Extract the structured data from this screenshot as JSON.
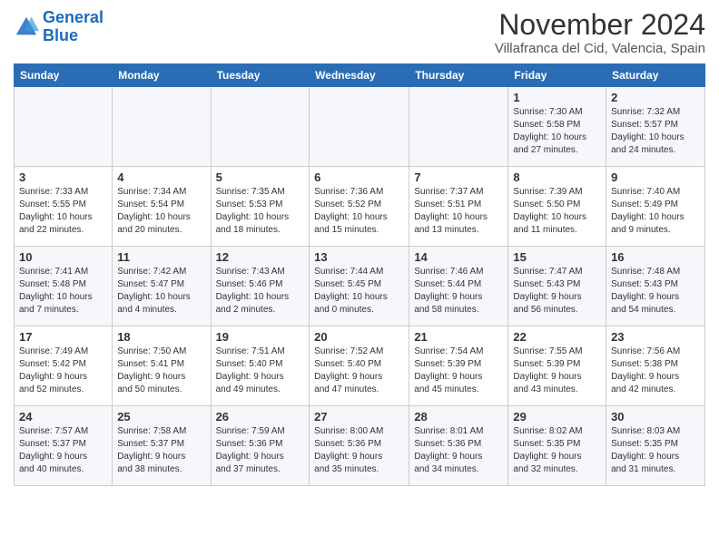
{
  "header": {
    "logo_line1": "General",
    "logo_line2": "Blue",
    "month": "November 2024",
    "location": "Villafranca del Cid, Valencia, Spain"
  },
  "weekdays": [
    "Sunday",
    "Monday",
    "Tuesday",
    "Wednesday",
    "Thursday",
    "Friday",
    "Saturday"
  ],
  "weeks": [
    [
      {
        "day": "",
        "info": ""
      },
      {
        "day": "",
        "info": ""
      },
      {
        "day": "",
        "info": ""
      },
      {
        "day": "",
        "info": ""
      },
      {
        "day": "",
        "info": ""
      },
      {
        "day": "1",
        "info": "Sunrise: 7:30 AM\nSunset: 5:58 PM\nDaylight: 10 hours\nand 27 minutes."
      },
      {
        "day": "2",
        "info": "Sunrise: 7:32 AM\nSunset: 5:57 PM\nDaylight: 10 hours\nand 24 minutes."
      }
    ],
    [
      {
        "day": "3",
        "info": "Sunrise: 7:33 AM\nSunset: 5:55 PM\nDaylight: 10 hours\nand 22 minutes."
      },
      {
        "day": "4",
        "info": "Sunrise: 7:34 AM\nSunset: 5:54 PM\nDaylight: 10 hours\nand 20 minutes."
      },
      {
        "day": "5",
        "info": "Sunrise: 7:35 AM\nSunset: 5:53 PM\nDaylight: 10 hours\nand 18 minutes."
      },
      {
        "day": "6",
        "info": "Sunrise: 7:36 AM\nSunset: 5:52 PM\nDaylight: 10 hours\nand 15 minutes."
      },
      {
        "day": "7",
        "info": "Sunrise: 7:37 AM\nSunset: 5:51 PM\nDaylight: 10 hours\nand 13 minutes."
      },
      {
        "day": "8",
        "info": "Sunrise: 7:39 AM\nSunset: 5:50 PM\nDaylight: 10 hours\nand 11 minutes."
      },
      {
        "day": "9",
        "info": "Sunrise: 7:40 AM\nSunset: 5:49 PM\nDaylight: 10 hours\nand 9 minutes."
      }
    ],
    [
      {
        "day": "10",
        "info": "Sunrise: 7:41 AM\nSunset: 5:48 PM\nDaylight: 10 hours\nand 7 minutes."
      },
      {
        "day": "11",
        "info": "Sunrise: 7:42 AM\nSunset: 5:47 PM\nDaylight: 10 hours\nand 4 minutes."
      },
      {
        "day": "12",
        "info": "Sunrise: 7:43 AM\nSunset: 5:46 PM\nDaylight: 10 hours\nand 2 minutes."
      },
      {
        "day": "13",
        "info": "Sunrise: 7:44 AM\nSunset: 5:45 PM\nDaylight: 10 hours\nand 0 minutes."
      },
      {
        "day": "14",
        "info": "Sunrise: 7:46 AM\nSunset: 5:44 PM\nDaylight: 9 hours\nand 58 minutes."
      },
      {
        "day": "15",
        "info": "Sunrise: 7:47 AM\nSunset: 5:43 PM\nDaylight: 9 hours\nand 56 minutes."
      },
      {
        "day": "16",
        "info": "Sunrise: 7:48 AM\nSunset: 5:43 PM\nDaylight: 9 hours\nand 54 minutes."
      }
    ],
    [
      {
        "day": "17",
        "info": "Sunrise: 7:49 AM\nSunset: 5:42 PM\nDaylight: 9 hours\nand 52 minutes."
      },
      {
        "day": "18",
        "info": "Sunrise: 7:50 AM\nSunset: 5:41 PM\nDaylight: 9 hours\nand 50 minutes."
      },
      {
        "day": "19",
        "info": "Sunrise: 7:51 AM\nSunset: 5:40 PM\nDaylight: 9 hours\nand 49 minutes."
      },
      {
        "day": "20",
        "info": "Sunrise: 7:52 AM\nSunset: 5:40 PM\nDaylight: 9 hours\nand 47 minutes."
      },
      {
        "day": "21",
        "info": "Sunrise: 7:54 AM\nSunset: 5:39 PM\nDaylight: 9 hours\nand 45 minutes."
      },
      {
        "day": "22",
        "info": "Sunrise: 7:55 AM\nSunset: 5:39 PM\nDaylight: 9 hours\nand 43 minutes."
      },
      {
        "day": "23",
        "info": "Sunrise: 7:56 AM\nSunset: 5:38 PM\nDaylight: 9 hours\nand 42 minutes."
      }
    ],
    [
      {
        "day": "24",
        "info": "Sunrise: 7:57 AM\nSunset: 5:37 PM\nDaylight: 9 hours\nand 40 minutes."
      },
      {
        "day": "25",
        "info": "Sunrise: 7:58 AM\nSunset: 5:37 PM\nDaylight: 9 hours\nand 38 minutes."
      },
      {
        "day": "26",
        "info": "Sunrise: 7:59 AM\nSunset: 5:36 PM\nDaylight: 9 hours\nand 37 minutes."
      },
      {
        "day": "27",
        "info": "Sunrise: 8:00 AM\nSunset: 5:36 PM\nDaylight: 9 hours\nand 35 minutes."
      },
      {
        "day": "28",
        "info": "Sunrise: 8:01 AM\nSunset: 5:36 PM\nDaylight: 9 hours\nand 34 minutes."
      },
      {
        "day": "29",
        "info": "Sunrise: 8:02 AM\nSunset: 5:35 PM\nDaylight: 9 hours\nand 32 minutes."
      },
      {
        "day": "30",
        "info": "Sunrise: 8:03 AM\nSunset: 5:35 PM\nDaylight: 9 hours\nand 31 minutes."
      }
    ]
  ]
}
